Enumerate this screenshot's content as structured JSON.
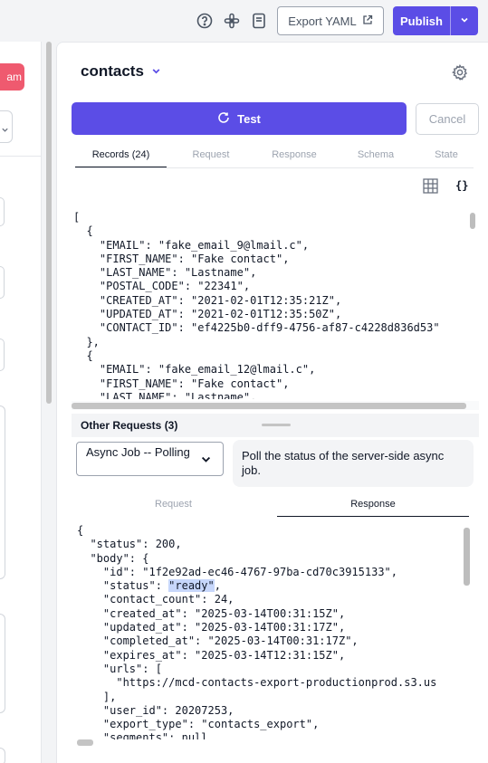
{
  "topbar": {
    "icons": [
      "help-circle-icon",
      "slack-icon",
      "book-icon"
    ],
    "export_label": "Export YAML",
    "publish_label": "Publish"
  },
  "left": {
    "badge_text": "am"
  },
  "panel": {
    "title": "contacts",
    "test_label": "Test",
    "cancel_label": "Cancel",
    "tabs": [
      "Records (24)",
      "Request",
      "Response",
      "Schema",
      "State"
    ],
    "active_tab": "Records (24)",
    "records_lines": [
      "[",
      "  {",
      "    \"EMAIL\": \"fake_email_9@lmail.c\",",
      "    \"FIRST_NAME\": \"Fake contact\",",
      "    \"LAST_NAME\": \"Lastname\",",
      "    \"POSTAL_CODE\": \"22341\",",
      "    \"CREATED_AT\": \"2021-02-01T12:35:21Z\",",
      "    \"UPDATED_AT\": \"2021-02-01T12:35:50Z\",",
      "    \"CONTACT_ID\": \"ef4225b0-dff9-4756-af87-c4228d836d53\"",
      "  },",
      "  {",
      "    \"EMAIL\": \"fake_email_12@lmail.c\",",
      "    \"FIRST_NAME\": \"Fake contact\",",
      "    \"LAST_NAME\": \"Lastname\","
    ],
    "other_requests": {
      "title": "Other Requests (3)",
      "selected": "Async Job -- Polling",
      "description": "Poll the status of the server-side async job.",
      "subtabs": [
        "Request",
        "Response"
      ],
      "active_subtab": "Response",
      "response_lines": [
        "{",
        "  \"status\": 200,",
        "  \"body\": {",
        "    \"id\": \"1f2e92ad-ec46-4767-97ba-cd70c3915133\",",
        "    \"status\": \"ready\",",
        "    \"contact_count\": 24,",
        "    \"created_at\": \"2025-03-14T00:31:15Z\",",
        "    \"updated_at\": \"2025-03-14T00:31:17Z\",",
        "    \"completed_at\": \"2025-03-14T00:31:17Z\",",
        "    \"expires_at\": \"2025-03-14T12:31:15Z\",",
        "    \"urls\": [",
        "      \"https://mcd-contacts-export-productionprod.s3.us",
        "    ],",
        "    \"user_id\": 20207253,",
        "    \"export_type\": \"contacts_export\",",
        "    \"segments\": null"
      ],
      "highlight": "\"ready\""
    }
  },
  "colors": {
    "accent": "#5b4de6",
    "danger": "#ef5a6f",
    "selection": "#c7d7fb"
  }
}
